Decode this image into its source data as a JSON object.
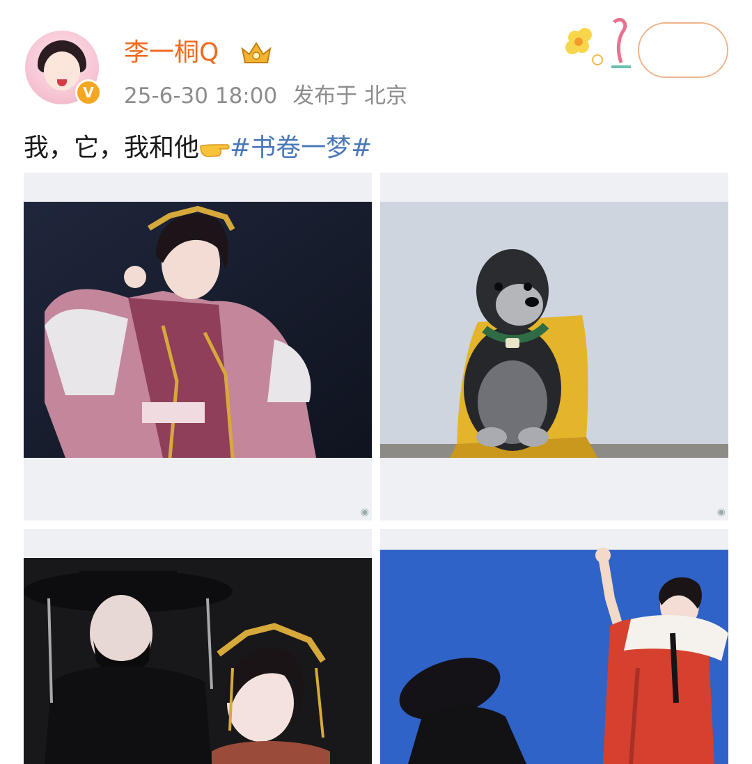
{
  "post": {
    "author": "李一桐Q",
    "timestamp": "25-6-30 18:00",
    "location_prefix": "发布于",
    "location": "北京",
    "text_prefix": "我，它，我和他",
    "hashtag": "#书卷一梦#"
  },
  "badges": {
    "verified_icon": "verified-v-icon",
    "membership_icon": "crown-icon"
  },
  "photos": [
    {
      "subject": "woman-in-pink-hanfu"
    },
    {
      "subject": "schnauzer-dog-on-yellow-chair"
    },
    {
      "subject": "masked-man-and-woman"
    },
    {
      "subject": "costumed-figures-blue-backdrop"
    }
  ],
  "colors": {
    "username": "#ef6a1c",
    "meta": "#8c8c8c",
    "hashtag": "#4a78b8",
    "verified": "#f5a623"
  }
}
